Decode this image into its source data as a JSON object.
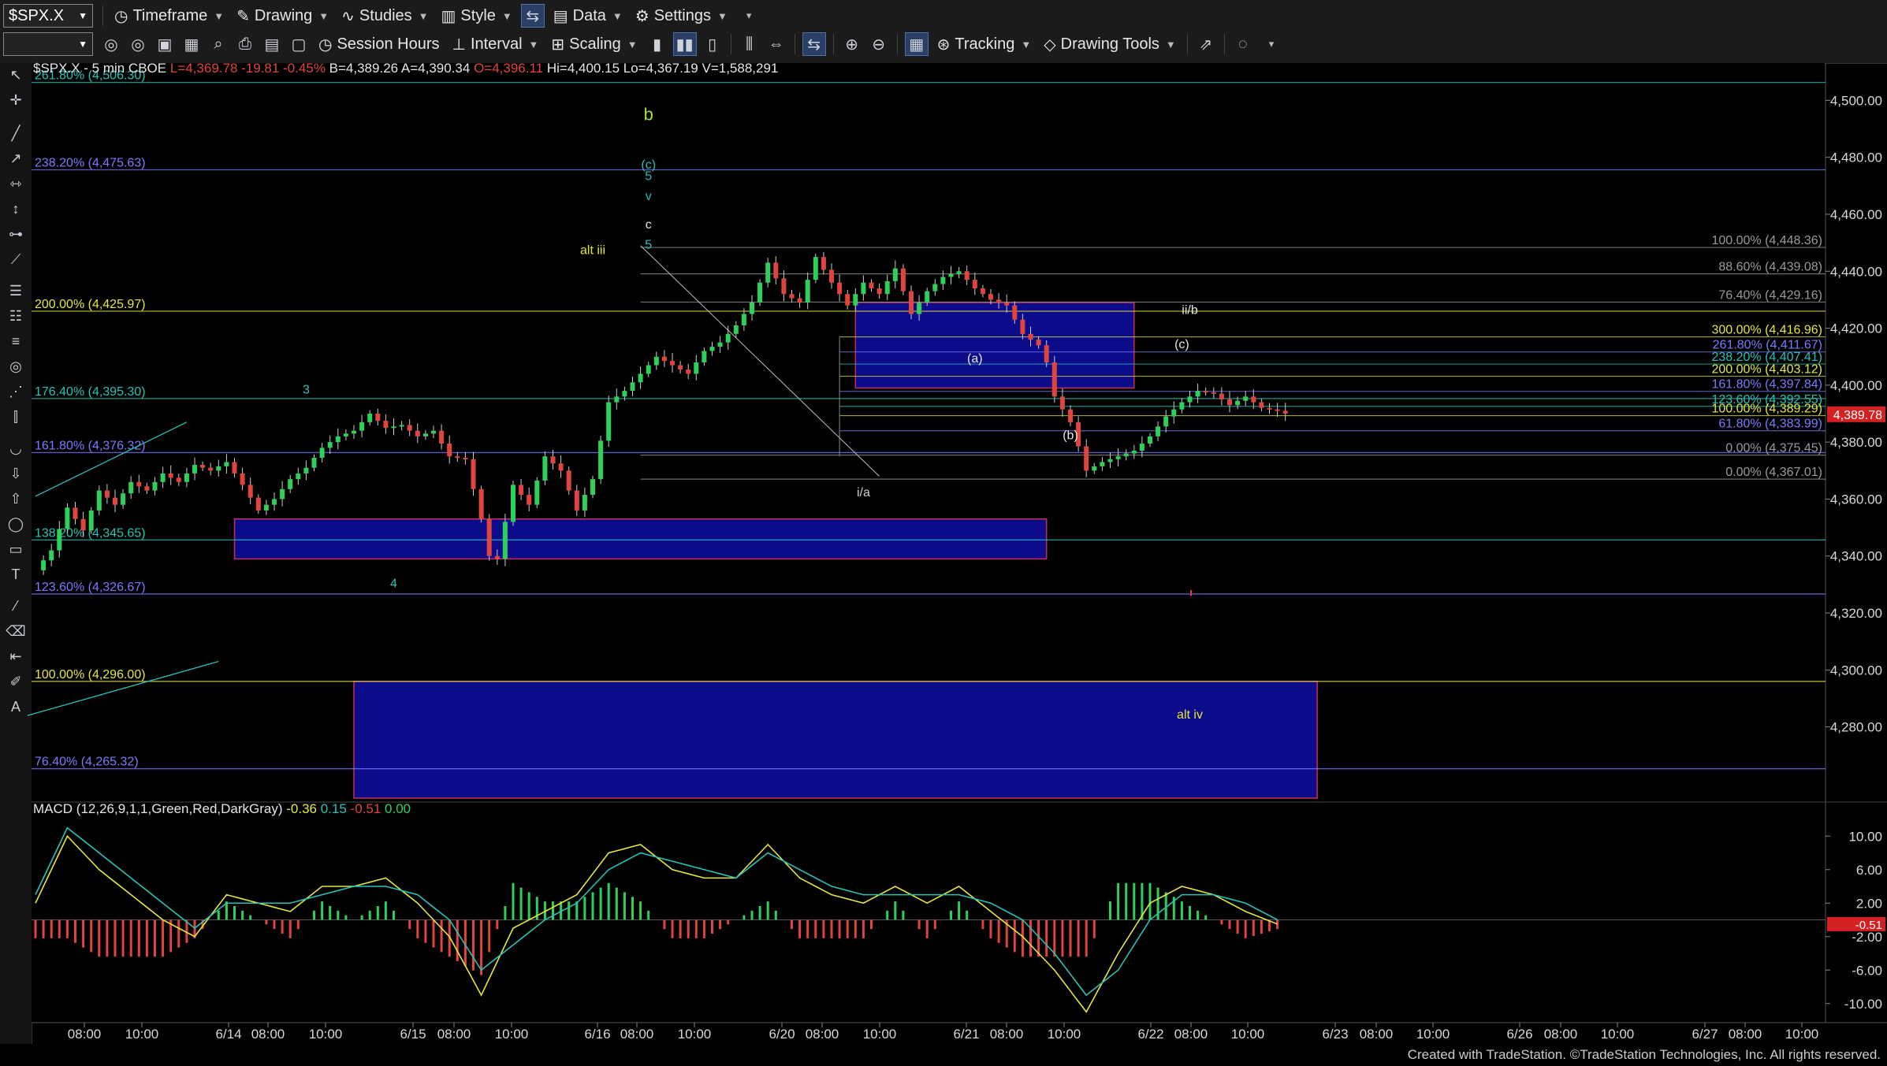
{
  "toolbar": {
    "symbol": "$SPX.X",
    "menus": [
      "Timeframe",
      "Drawing",
      "Studies",
      "Style",
      "Data",
      "Settings"
    ],
    "row2": {
      "session_hours": "Session Hours",
      "interval": "Interval",
      "scaling": "Scaling",
      "tracking": "Tracking",
      "drawing_tools": "Drawing Tools"
    }
  },
  "chart_data": {
    "type": "candlestick",
    "header": {
      "symbol_line": "$SPX.X - 5 min  CBOE",
      "last": "L=4,369.78",
      "change": "-19.81",
      "change_pct": "-0.45%",
      "bid": "B=4,389.26",
      "ask": "A=4,390.34",
      "open": "O=4,396.11",
      "high": "Hi=4,400.15",
      "low": "Lo=4,367.19",
      "volume": "V=1,588,291"
    },
    "ylim": [
      4255,
      4512
    ],
    "yticks": [
      "4,500.00",
      "4,480.00",
      "4,460.00",
      "4,440.00",
      "4,420.00",
      "4,400.00",
      "4,380.00",
      "4,360.00",
      "4,340.00",
      "4,320.00",
      "4,300.00",
      "4,280.00"
    ],
    "ytick_values": [
      4500,
      4480,
      4460,
      4440,
      4420,
      4400,
      4380,
      4360,
      4340,
      4320,
      4300,
      4280
    ],
    "last_price_badge": "4,389.78",
    "last_price_value": 4389.78,
    "xticks": [
      "08:00",
      "10:00",
      "6/14",
      "08:00",
      "10:00",
      "6/15",
      "08:00",
      "10:00",
      "6/16",
      "08:00",
      "10:00",
      "6/20",
      "08:00",
      "10:00",
      "6/21",
      "08:00",
      "10:00",
      "6/22",
      "08:00",
      "10:00",
      "6/23",
      "08:00",
      "10:00",
      "6/26",
      "08:00",
      "10:00",
      "6/27",
      "08:00",
      "10:00"
    ],
    "price_path": [
      [
        0,
        4335
      ],
      [
        2,
        4342
      ],
      [
        4,
        4357
      ],
      [
        6,
        4349
      ],
      [
        8,
        4363
      ],
      [
        10,
        4358
      ],
      [
        12,
        4366
      ],
      [
        14,
        4363
      ],
      [
        16,
        4369
      ],
      [
        18,
        4366
      ],
      [
        20,
        4372
      ],
      [
        22,
        4370
      ],
      [
        24,
        4373
      ],
      [
        26,
        4365
      ],
      [
        28,
        4356
      ],
      [
        30,
        4360
      ],
      [
        32,
        4367
      ],
      [
        34,
        4371
      ],
      [
        36,
        4378
      ],
      [
        38,
        4382
      ],
      [
        40,
        4384
      ],
      [
        42,
        4390
      ],
      [
        44,
        4385
      ],
      [
        46,
        4386
      ],
      [
        48,
        4382
      ],
      [
        50,
        4384
      ],
      [
        52,
        4375
      ],
      [
        54,
        4374
      ],
      [
        56,
        4353
      ],
      [
        57,
        4340
      ],
      [
        58,
        4339
      ],
      [
        60,
        4365
      ],
      [
        62,
        4358
      ],
      [
        64,
        4375
      ],
      [
        66,
        4370
      ],
      [
        68,
        4356
      ],
      [
        70,
        4367
      ],
      [
        72,
        4394
      ],
      [
        74,
        4398
      ],
      [
        76,
        4404
      ],
      [
        78,
        4410
      ],
      [
        80,
        4407
      ],
      [
        82,
        4404
      ],
      [
        84,
        4412
      ],
      [
        86,
        4415
      ],
      [
        88,
        4421
      ],
      [
        90,
        4429
      ],
      [
        92,
        4443
      ],
      [
        94,
        4432
      ],
      [
        96,
        4429
      ],
      [
        98,
        4445
      ],
      [
        100,
        4436
      ],
      [
        102,
        4428
      ],
      [
        104,
        4436
      ],
      [
        106,
        4432
      ],
      [
        108,
        4441
      ],
      [
        110,
        4425
      ],
      [
        112,
        4433
      ],
      [
        114,
        4438
      ],
      [
        116,
        4440
      ],
      [
        118,
        4434
      ],
      [
        120,
        4430
      ],
      [
        122,
        4428
      ],
      [
        124,
        4418
      ],
      [
        126,
        4414
      ],
      [
        127,
        4408
      ],
      [
        128,
        4396
      ],
      [
        130,
        4387
      ],
      [
        132,
        4370
      ],
      [
        134,
        4373
      ],
      [
        136,
        4375
      ],
      [
        138,
        4377
      ],
      [
        140,
        4382
      ],
      [
        142,
        4389
      ],
      [
        144,
        4394
      ],
      [
        146,
        4398
      ],
      [
        148,
        4397
      ],
      [
        150,
        4393
      ],
      [
        152,
        4396
      ],
      [
        154,
        4392
      ],
      [
        156,
        4391
      ],
      [
        157,
        4390
      ]
    ],
    "macd_path": [
      [
        0,
        2
      ],
      [
        4,
        10
      ],
      [
        8,
        6
      ],
      [
        12,
        3
      ],
      [
        16,
        0
      ],
      [
        20,
        -2
      ],
      [
        24,
        3
      ],
      [
        28,
        2
      ],
      [
        32,
        1
      ],
      [
        36,
        4
      ],
      [
        40,
        4
      ],
      [
        44,
        5
      ],
      [
        48,
        2
      ],
      [
        52,
        -2
      ],
      [
        56,
        -9
      ],
      [
        60,
        -1
      ],
      [
        64,
        1
      ],
      [
        68,
        3
      ],
      [
        72,
        8
      ],
      [
        76,
        9
      ],
      [
        80,
        6
      ],
      [
        84,
        5
      ],
      [
        88,
        5
      ],
      [
        92,
        9
      ],
      [
        96,
        5
      ],
      [
        100,
        3
      ],
      [
        104,
        2
      ],
      [
        108,
        4
      ],
      [
        112,
        2
      ],
      [
        116,
        4
      ],
      [
        120,
        1
      ],
      [
        124,
        -2
      ],
      [
        128,
        -6
      ],
      [
        132,
        -11
      ],
      [
        136,
        -4
      ],
      [
        140,
        2
      ],
      [
        144,
        4
      ],
      [
        148,
        3
      ],
      [
        152,
        1
      ],
      [
        156,
        -0.5
      ]
    ],
    "signal_path": [
      [
        0,
        3
      ],
      [
        4,
        11
      ],
      [
        8,
        8
      ],
      [
        12,
        5
      ],
      [
        16,
        2
      ],
      [
        20,
        -1
      ],
      [
        24,
        2
      ],
      [
        28,
        2
      ],
      [
        32,
        2
      ],
      [
        36,
        3
      ],
      [
        40,
        4
      ],
      [
        44,
        4
      ],
      [
        48,
        3
      ],
      [
        52,
        0
      ],
      [
        56,
        -6
      ],
      [
        60,
        -3
      ],
      [
        64,
        0
      ],
      [
        68,
        2
      ],
      [
        72,
        6
      ],
      [
        76,
        8
      ],
      [
        80,
        7
      ],
      [
        84,
        6
      ],
      [
        88,
        5
      ],
      [
        92,
        8
      ],
      [
        96,
        6
      ],
      [
        100,
        4
      ],
      [
        104,
        3
      ],
      [
        108,
        3
      ],
      [
        112,
        3
      ],
      [
        116,
        3
      ],
      [
        120,
        2
      ],
      [
        124,
        0
      ],
      [
        128,
        -4
      ],
      [
        132,
        -9
      ],
      [
        136,
        -6
      ],
      [
        140,
        0
      ],
      [
        144,
        3
      ],
      [
        148,
        3
      ],
      [
        152,
        2
      ],
      [
        156,
        0
      ]
    ],
    "left_fibs": [
      {
        "label": "261.80% (4,506.30)",
        "value": 4506.3,
        "color": "#28c2b6"
      },
      {
        "label": "238.20% (4,475.63)",
        "value": 4475.63,
        "color": "#7a7aff"
      },
      {
        "label": "200.00% (4,425.97)",
        "value": 4425.97,
        "color": "#e6e640"
      },
      {
        "label": "176.40% (4,395.30)",
        "value": 4395.3,
        "color": "#28c2b6"
      },
      {
        "label": "161.80% (4,376.32)",
        "value": 4376.32,
        "color": "#7a7aff"
      },
      {
        "label": "138.20% (4,345.65)",
        "value": 4345.65,
        "color": "#28c2b6"
      },
      {
        "label": "123.60% (4,326.67)",
        "value": 4326.67,
        "color": "#7a7aff"
      },
      {
        "label": "100.00% (4,296.00)",
        "value": 4296.0,
        "color": "#e6e640"
      },
      {
        "label": "76.40% (4,265.32)",
        "value": 4265.32,
        "color": "#7a7aff"
      }
    ],
    "right_fibs": [
      {
        "label": "100.00% (4,448.36)",
        "value": 4448.36,
        "color": "#9a9a9a"
      },
      {
        "label": "88.60% (4,439.08)",
        "value": 4439.08,
        "color": "#9a9a9a"
      },
      {
        "label": "76.40% (4,429.16)",
        "value": 4429.16,
        "color": "#9a9a9a"
      },
      {
        "label": "300.00% (4,416.96)",
        "value": 4416.96,
        "color": "#e6e640"
      },
      {
        "label": "261.80% (4,411.67)",
        "value": 4411.67,
        "color": "#7a7aff"
      },
      {
        "label": "238.20% (4,407.41)",
        "value": 4407.41,
        "color": "#28c2b6"
      },
      {
        "label": "200.00% (4,403.12)",
        "value": 4403.12,
        "color": "#e6e640"
      },
      {
        "label": "161.80% (4,397.84)",
        "value": 4397.84,
        "color": "#7a7aff"
      },
      {
        "label": "123.60% (4,392.55)",
        "value": 4392.55,
        "color": "#28c2b6"
      },
      {
        "label": "100.00% (4,389.29)",
        "value": 4389.29,
        "color": "#e6e640"
      },
      {
        "label": "61.80% (4,383.99)",
        "value": 4383.99,
        "color": "#7a7aff"
      },
      {
        "label": "0.00% (4,375.45)",
        "value": 4375.45,
        "color": "#9a9a9a"
      },
      {
        "label": "0.00% (4,367.01)",
        "value": 4367.01,
        "color": "#9a9a9a"
      }
    ],
    "zones": [
      {
        "name": "upper target box",
        "from_x": 103,
        "to_x": 138,
        "from_y": 4399,
        "to_y": 4429
      },
      {
        "name": "support box",
        "from_x": 25,
        "to_x": 127,
        "from_y": 4339,
        "to_y": 4353
      },
      {
        "name": "alt iv box",
        "from_x": 40,
        "to_x": 161,
        "from_y": 4255,
        "to_y": 4296
      }
    ],
    "wave_labels": [
      {
        "text": "b",
        "x": 77,
        "y": 4493,
        "color": "#9be24a"
      },
      {
        "text": "(c)",
        "x": 77,
        "y": 4476,
        "color": "#28c2b6"
      },
      {
        "text": "5",
        "x": 77,
        "y": 4472,
        "color": "#28c2b6"
      },
      {
        "text": "v",
        "x": 77,
        "y": 4465,
        "color": "#28c2b6"
      },
      {
        "text": "c",
        "x": 77,
        "y": 4455,
        "color": "#e6e6e6"
      },
      {
        "text": "5",
        "x": 77,
        "y": 4448,
        "color": "#28c2b6"
      },
      {
        "text": "alt iii",
        "x": 70,
        "y": 4446,
        "color": "#e6e640"
      },
      {
        "text": "3",
        "x": 34,
        "y": 4397,
        "color": "#28c2b6"
      },
      {
        "text": "4",
        "x": 45,
        "y": 4329,
        "color": "#28c2b6"
      },
      {
        "text": "i/a",
        "x": 104,
        "y": 4361,
        "color": "#d0d0d0"
      },
      {
        "text": "(a)",
        "x": 118,
        "y": 4408,
        "color": "#e6e6e6"
      },
      {
        "text": "(b)",
        "x": 130,
        "y": 4381,
        "color": "#e6e6e6"
      },
      {
        "text": "ii/b",
        "x": 145,
        "y": 4425,
        "color": "#e6e6e6"
      },
      {
        "text": "(c)",
        "x": 144,
        "y": 4413,
        "color": "#e6e6e6"
      },
      {
        "text": "alt iv",
        "x": 145,
        "y": 4283,
        "color": "#e6e640"
      }
    ],
    "macd": {
      "title": "MACD (12,26,9,1,1,Green,Red,DarkGray)",
      "values": [
        "-0.36",
        "0.15",
        "-0.51",
        "0.00"
      ],
      "yticks": [
        "10.00",
        "6.00",
        "2.00",
        "-2.00",
        "-6.00",
        "-10.00"
      ],
      "ytick_values": [
        10,
        6,
        2,
        -2,
        -6,
        -10
      ],
      "ylim": [
        -12,
        12
      ],
      "badge": "-0.51"
    }
  },
  "footer": "Created with TradeStation. ©TradeStation Technologies, Inc. All rights reserved."
}
